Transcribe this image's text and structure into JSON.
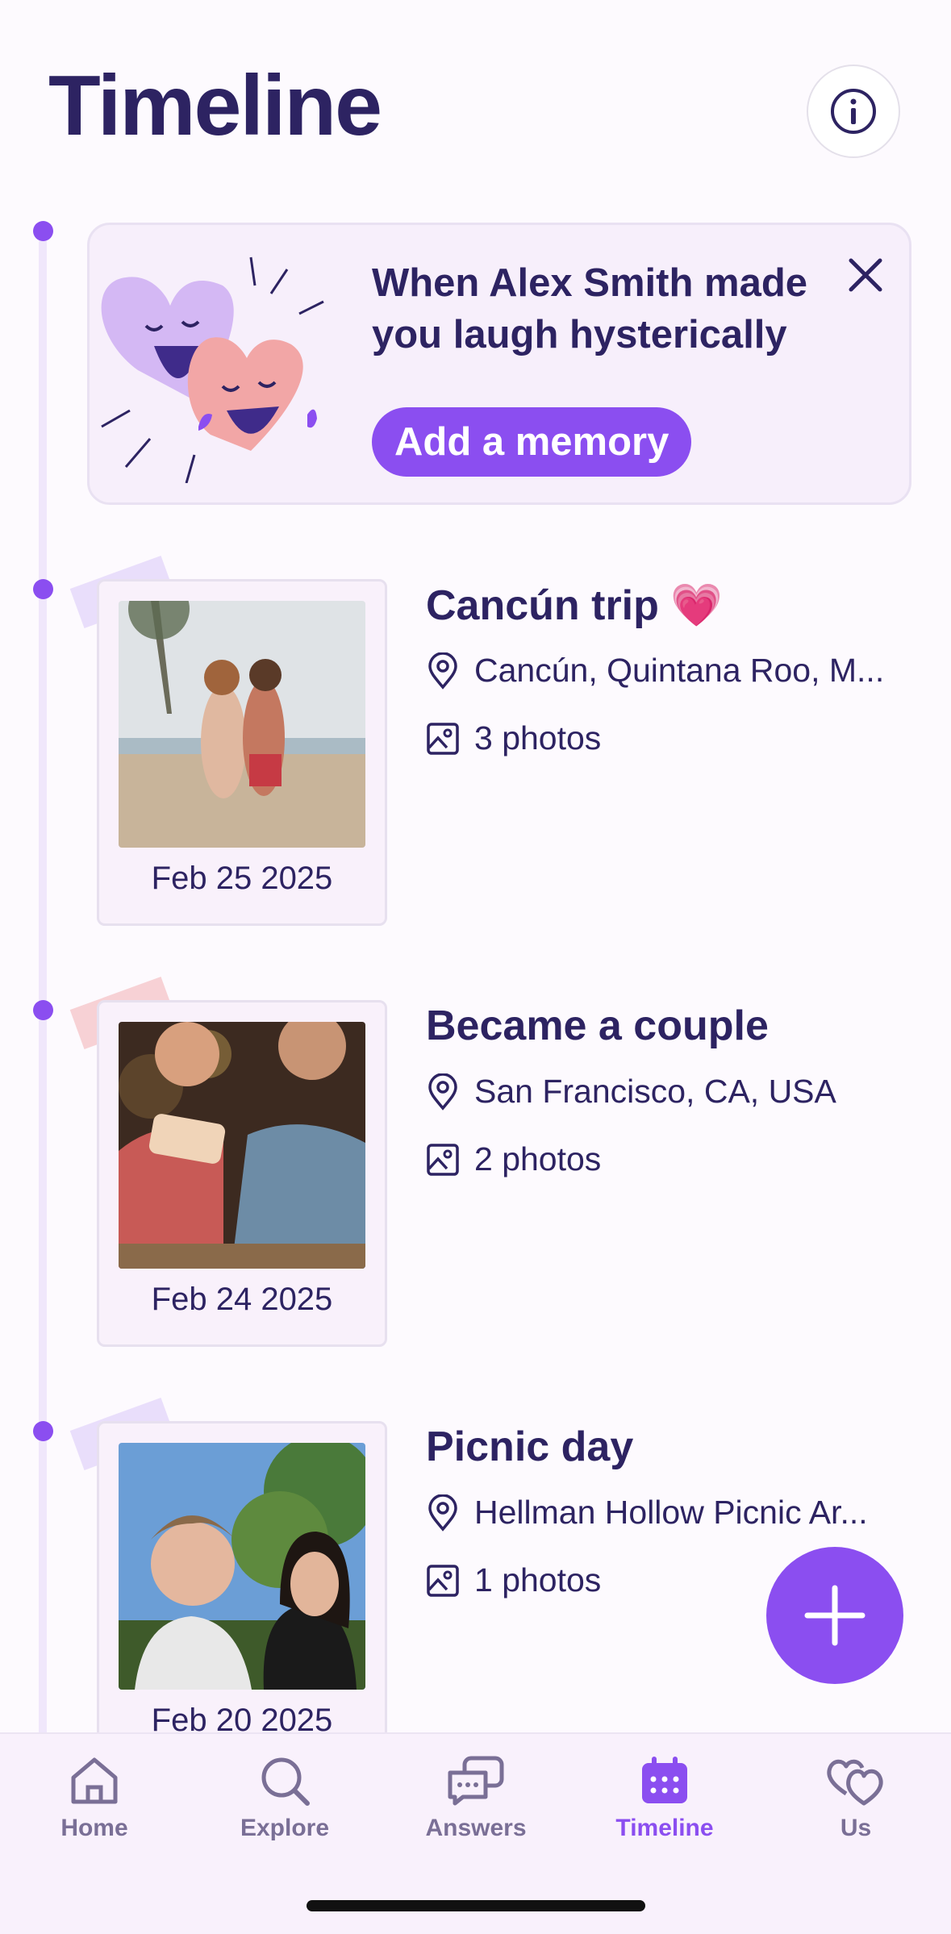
{
  "header": {
    "title": "Timeline",
    "info_icon": "info-icon"
  },
  "prompt_card": {
    "text": "When Alex Smith made you laugh hysterically",
    "button_label": "Add a memory",
    "close_icon": "close-icon"
  },
  "entries": [
    {
      "date": "Feb 25 2025",
      "title": "Cancún trip 💗",
      "location": "Cancún, Quintana Roo, M...",
      "photos": "3 photos"
    },
    {
      "date": "Feb 24 2025",
      "title": "Became a couple",
      "location": "San Francisco, CA, USA",
      "photos": "2 photos"
    },
    {
      "date": "Feb 20 2025",
      "title": "Picnic day",
      "location": "Hellman Hollow Picnic Ar...",
      "photos": "1 photos"
    }
  ],
  "tabs": [
    {
      "label": "Home",
      "icon": "home-icon"
    },
    {
      "label": "Explore",
      "icon": "search-icon"
    },
    {
      "label": "Answers",
      "icon": "chat-bubbles-icon"
    },
    {
      "label": "Timeline",
      "icon": "calendar-icon",
      "active": true
    },
    {
      "label": "Us",
      "icon": "hearts-icon"
    }
  ],
  "colors": {
    "accent": "#8b4ef0",
    "text": "#2d2362",
    "muted": "#7a6f96"
  }
}
